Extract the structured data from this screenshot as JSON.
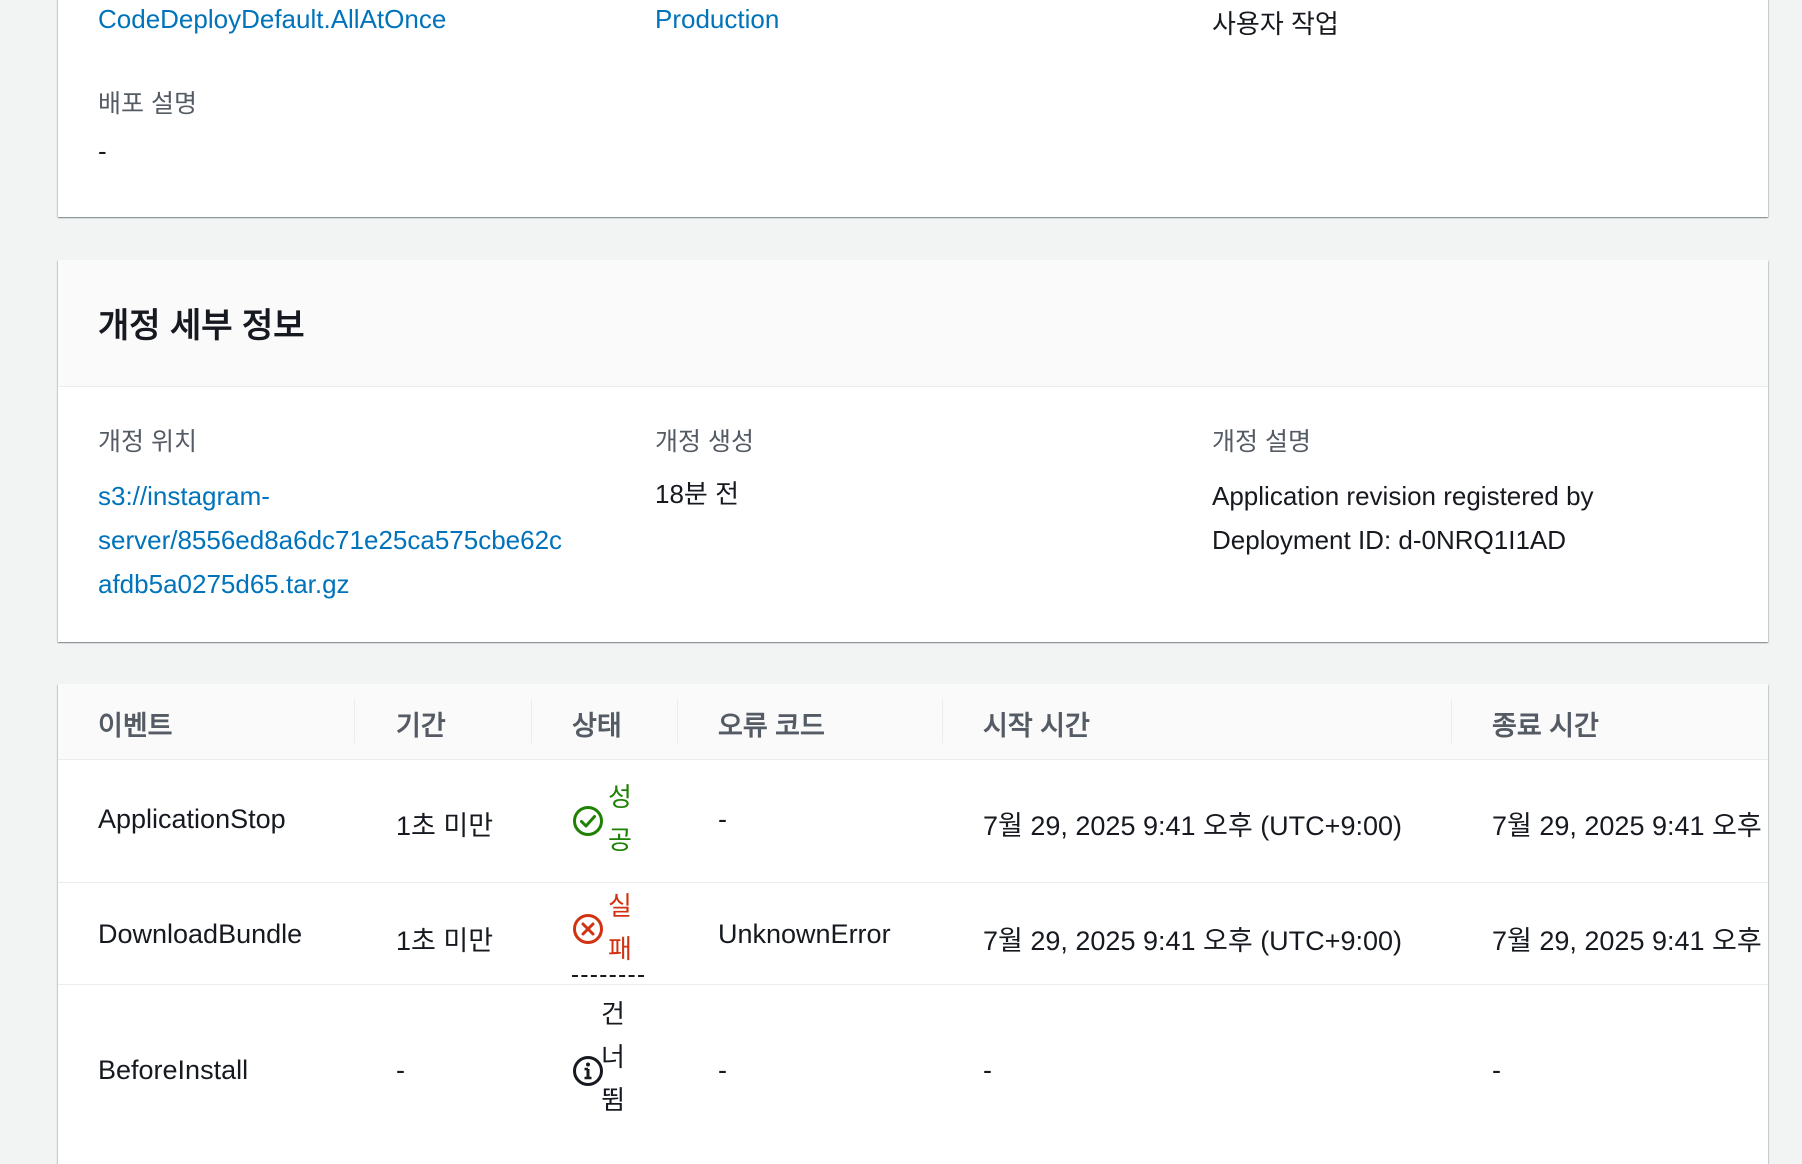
{
  "deployment": {
    "config_value": "CodeDeployDefault.AllAtOnce",
    "group_value": "Production",
    "initiator_value": "사용자 작업",
    "description_label": "배포 설명",
    "description_value": "-"
  },
  "revision": {
    "title": "개정 세부 정보",
    "location_label": "개정 위치",
    "location_value_line1": "s3://instagram-",
    "location_value_line2": "server/8556ed8a6dc71e25ca575cbe62c",
    "location_value_line3": "afdb5a0275d65.tar.gz",
    "created_label": "개정 생성",
    "created_value": "18분 전",
    "desc_label": "개정 설명",
    "desc_value_line1": "Application revision registered by",
    "desc_value_line2": "Deployment ID: d-0NRQ1I1AD"
  },
  "events": {
    "columns": [
      "이벤트",
      "기간",
      "상태",
      "오류 코드",
      "시작 시간",
      "종료 시간"
    ],
    "rows": [
      {
        "event": "ApplicationStop",
        "duration": "1초 미만",
        "status_line1": "성",
        "status_line2": "공",
        "error_code": "-",
        "start_time": "7월 29, 2025 9:41 오후 (UTC+9:00)",
        "end_time": "7월 29, 2025 9:41 오후"
      },
      {
        "event": "DownloadBundle",
        "duration": "1초 미만",
        "status_line1": "실",
        "status_line2": "패",
        "error_code": "UnknownError",
        "start_time": "7월 29, 2025 9:41 오후 (UTC+9:00)",
        "end_time": "7월 29, 2025 9:41 오후"
      },
      {
        "event": "BeforeInstall",
        "duration": "-",
        "status_line1": "건",
        "status_line2": "너",
        "status_line3": "뜀",
        "error_code": "-",
        "start_time": "-",
        "end_time": "-"
      }
    ]
  },
  "colors": {
    "link": "#0073bb",
    "success": "#1d8102",
    "error": "#d13212",
    "background": "#f2f3f3"
  }
}
